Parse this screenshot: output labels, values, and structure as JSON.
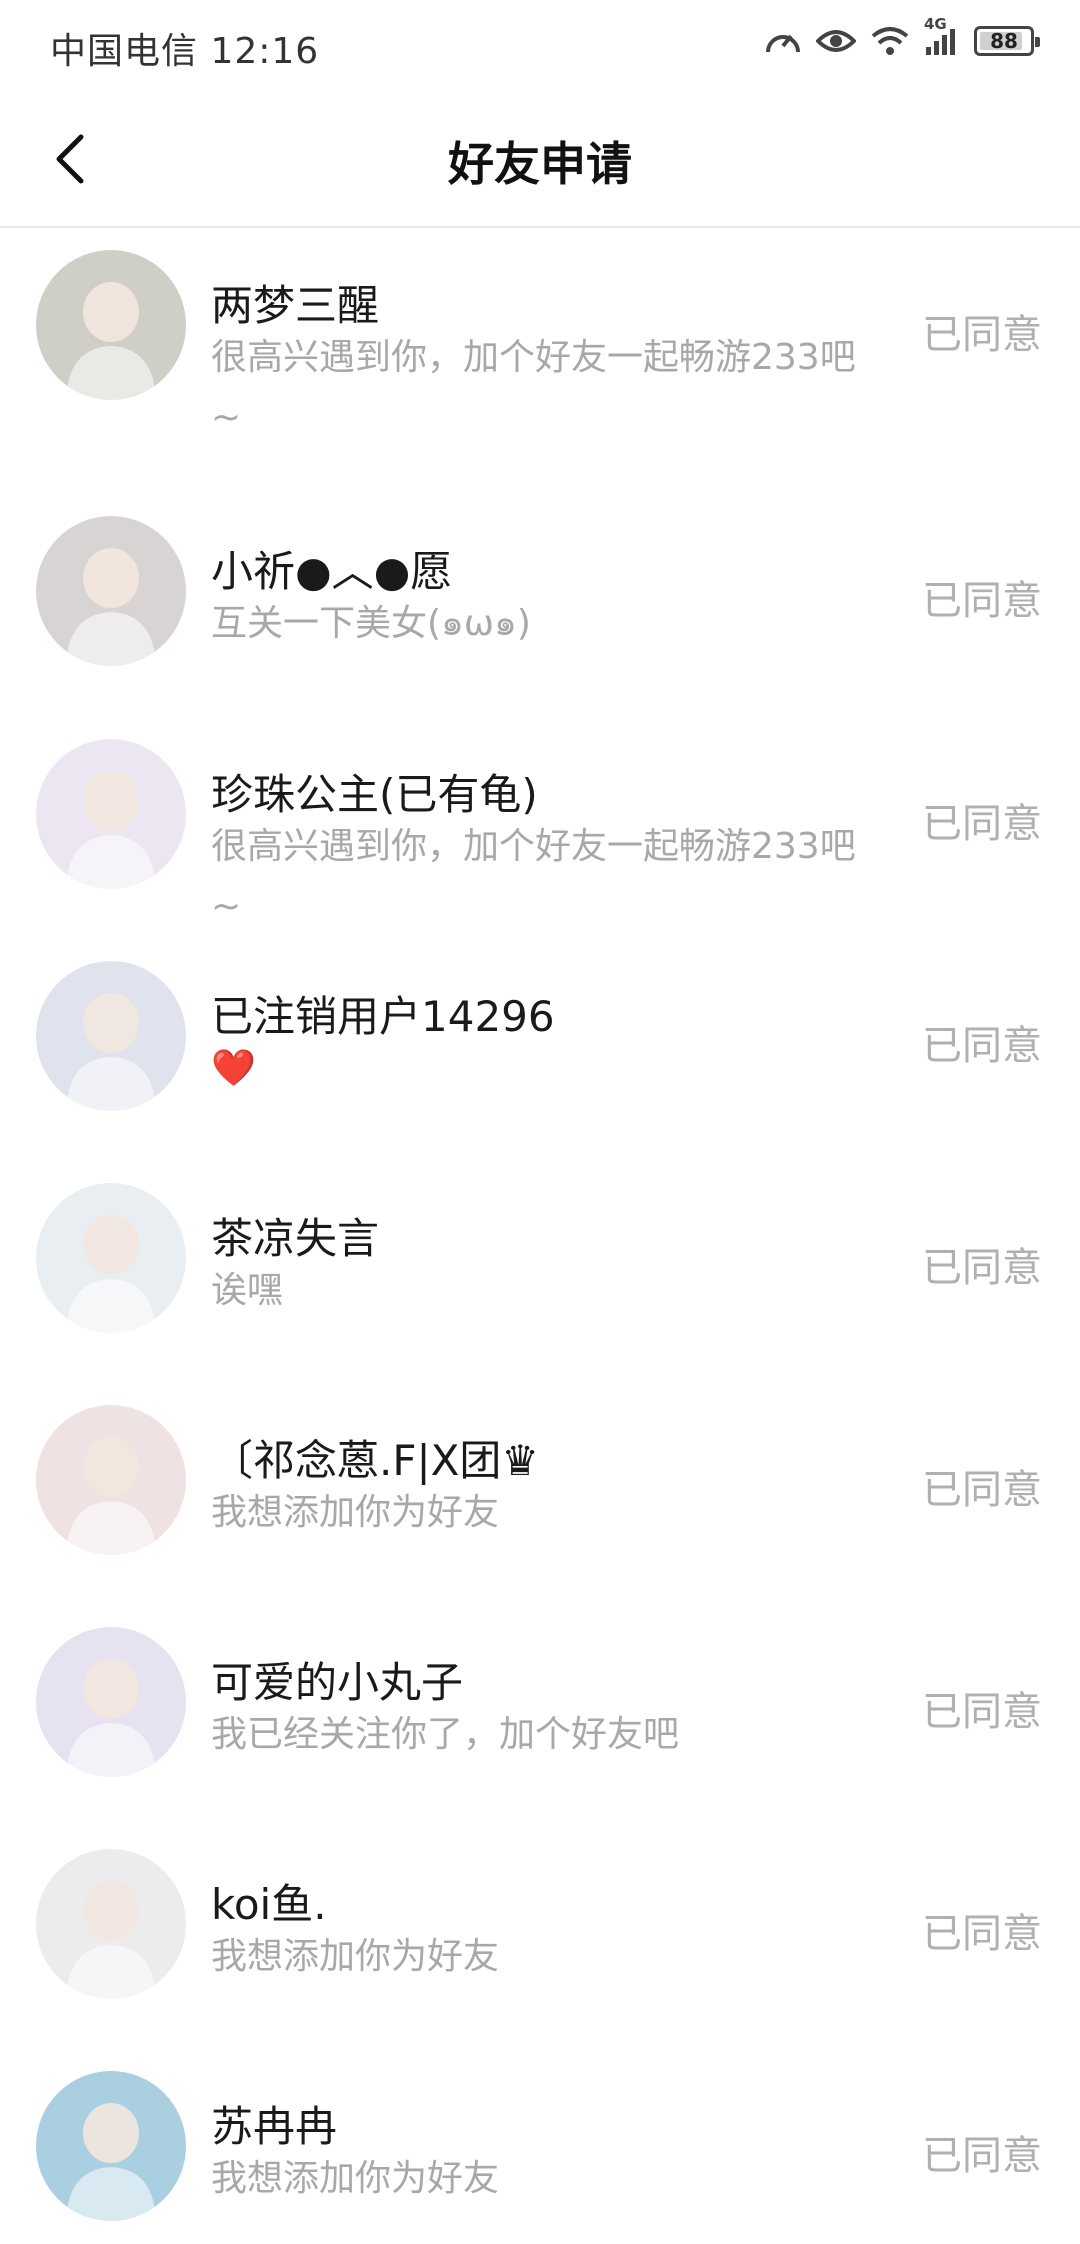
{
  "status_bar": {
    "carrier_time": "中国电信 12:16",
    "network": "4G",
    "battery": "88",
    "battery_level": 0.88
  },
  "header": {
    "title": "好友申请",
    "back_icon": "chevron-left-icon"
  },
  "requests": [
    {
      "name": "两梦三醒",
      "message": "很高兴遇到你，加个好友一起畅游233吧~",
      "status": "已同意",
      "avatar_color": "#cfcfc8"
    },
    {
      "name": "小祈●︿●愿",
      "message": "互关一下美女(๑ω๑)",
      "status": "已同意",
      "avatar_color": "#d9d4d4"
    },
    {
      "name": "珍珠公主(已有龟)",
      "message": "很高兴遇到你，加个好友一起畅游233吧~",
      "status": "已同意",
      "avatar_color": "#ece6f2"
    },
    {
      "name": "已注销用户14296",
      "message": "❤️",
      "status": "已同意",
      "avatar_color": "#e0e3ee"
    },
    {
      "name": "茶凉失言",
      "message": "诶嘿",
      "status": "已同意",
      "avatar_color": "#e9eef2"
    },
    {
      "name": "〔祁念蒽.F|X团♛",
      "message": "我想添加你为好友",
      "status": "已同意",
      "avatar_color": "#efe2e2"
    },
    {
      "name": "可爱的小丸子",
      "message": "我已经关注你了，加个好友吧",
      "status": "已同意",
      "avatar_color": "#e6e2f0"
    },
    {
      "name": "koi鱼.",
      "message": "我想添加你为好友",
      "status": "已同意",
      "avatar_color": "#ececef"
    },
    {
      "name": "苏冉冉",
      "message": "我想添加你为好友",
      "status": "已同意",
      "avatar_color": "#a9cfe0"
    }
  ]
}
